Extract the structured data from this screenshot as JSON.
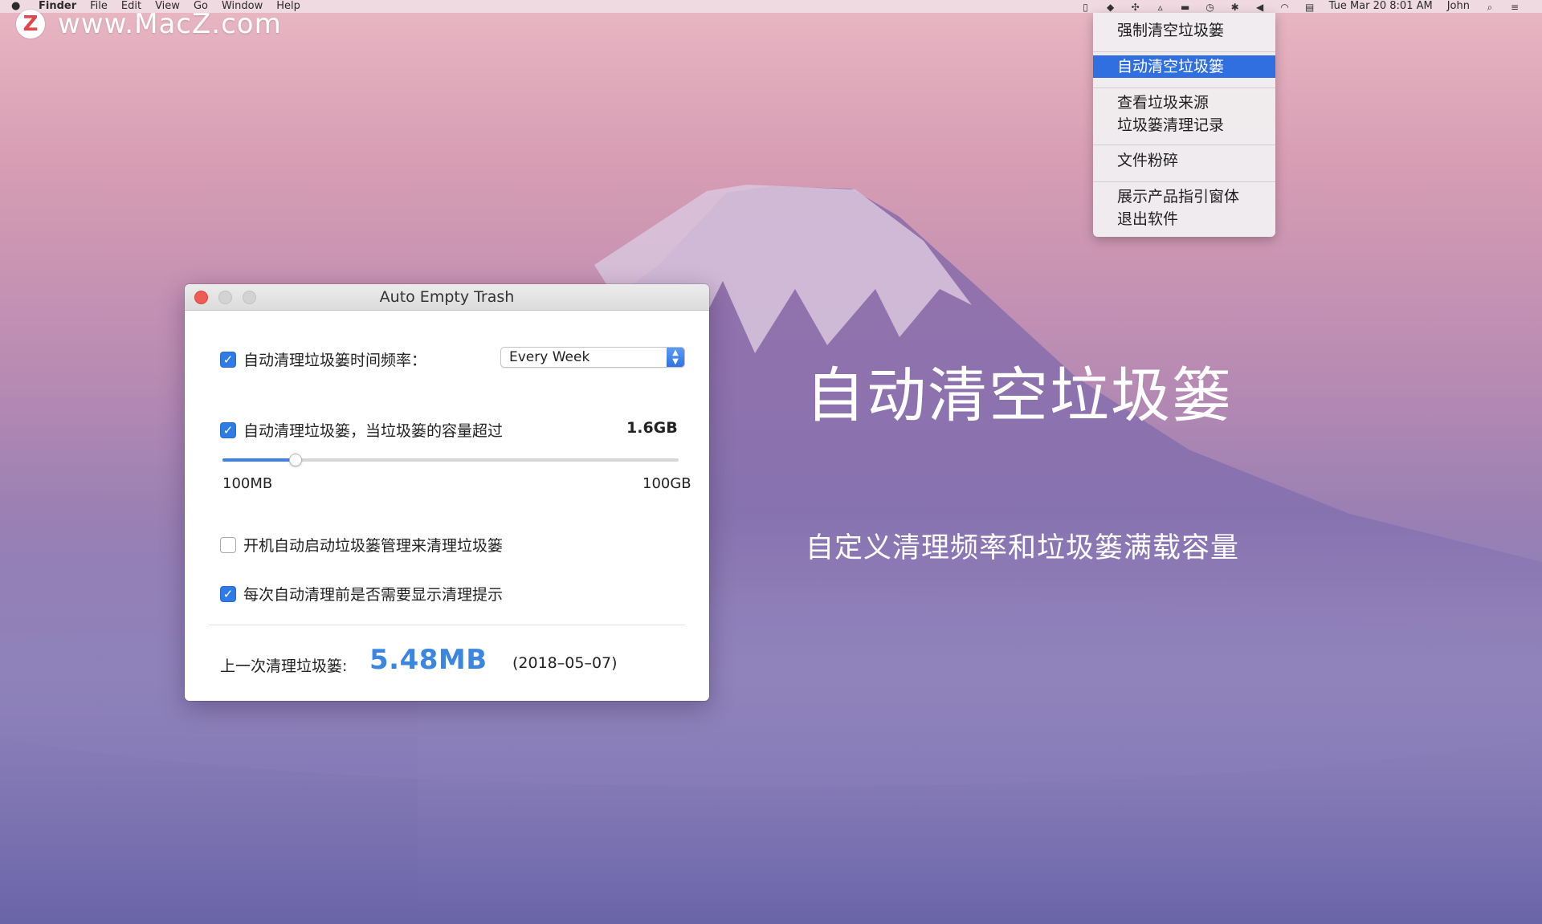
{
  "menubar": {
    "apple": "",
    "app_name": "Finder",
    "menus": [
      "File",
      "Edit",
      "View",
      "Go",
      "Window",
      "Help"
    ],
    "clock": "Tue Mar 20  8:01 AM",
    "user": "John"
  },
  "watermark": {
    "logo": "Z",
    "site": "www.MacZ.com"
  },
  "dropdown": {
    "items": [
      {
        "label": "强制清空垃圾篓"
      },
      {
        "label": "自动清空垃圾篓"
      },
      {
        "label": "查看垃圾来源"
      },
      {
        "label": "垃圾篓清理记录"
      },
      {
        "label": "文件粉碎"
      },
      {
        "label": "展示产品指引窗体"
      },
      {
        "label": "退出软件"
      }
    ],
    "selected_index": 1
  },
  "promo": {
    "title": "自动清空垃圾篓",
    "subtitle": "自定义清理频率和垃圾篓满载容量"
  },
  "window": {
    "title": "Auto Empty Trash",
    "frequency": {
      "checked": true,
      "label": "自动清理垃圾篓时间频率：",
      "selected": "Every Week"
    },
    "capacity": {
      "checked": true,
      "label": "自动清理垃圾篓，当垃圾篓的容量超过",
      "value": "1.6GB",
      "slider_min": "100MB",
      "slider_max": "100GB",
      "slider_fraction": 0.16
    },
    "launch_at_login": {
      "checked": false,
      "label": "开机自动启动垃圾篓管理来清理垃圾篓"
    },
    "show_prompt": {
      "checked": true,
      "label": "每次自动清理前是否需要显示清理提示"
    },
    "last_clean": {
      "label": "上一次清理垃圾篓:",
      "size": "5.48MB",
      "date": "(2018–05–07)"
    }
  },
  "colors": {
    "accent": "#2f7be6",
    "menu_highlight": "#2f6fe0",
    "close_button": "#ee5c55",
    "size_text": "#3a86e0"
  }
}
